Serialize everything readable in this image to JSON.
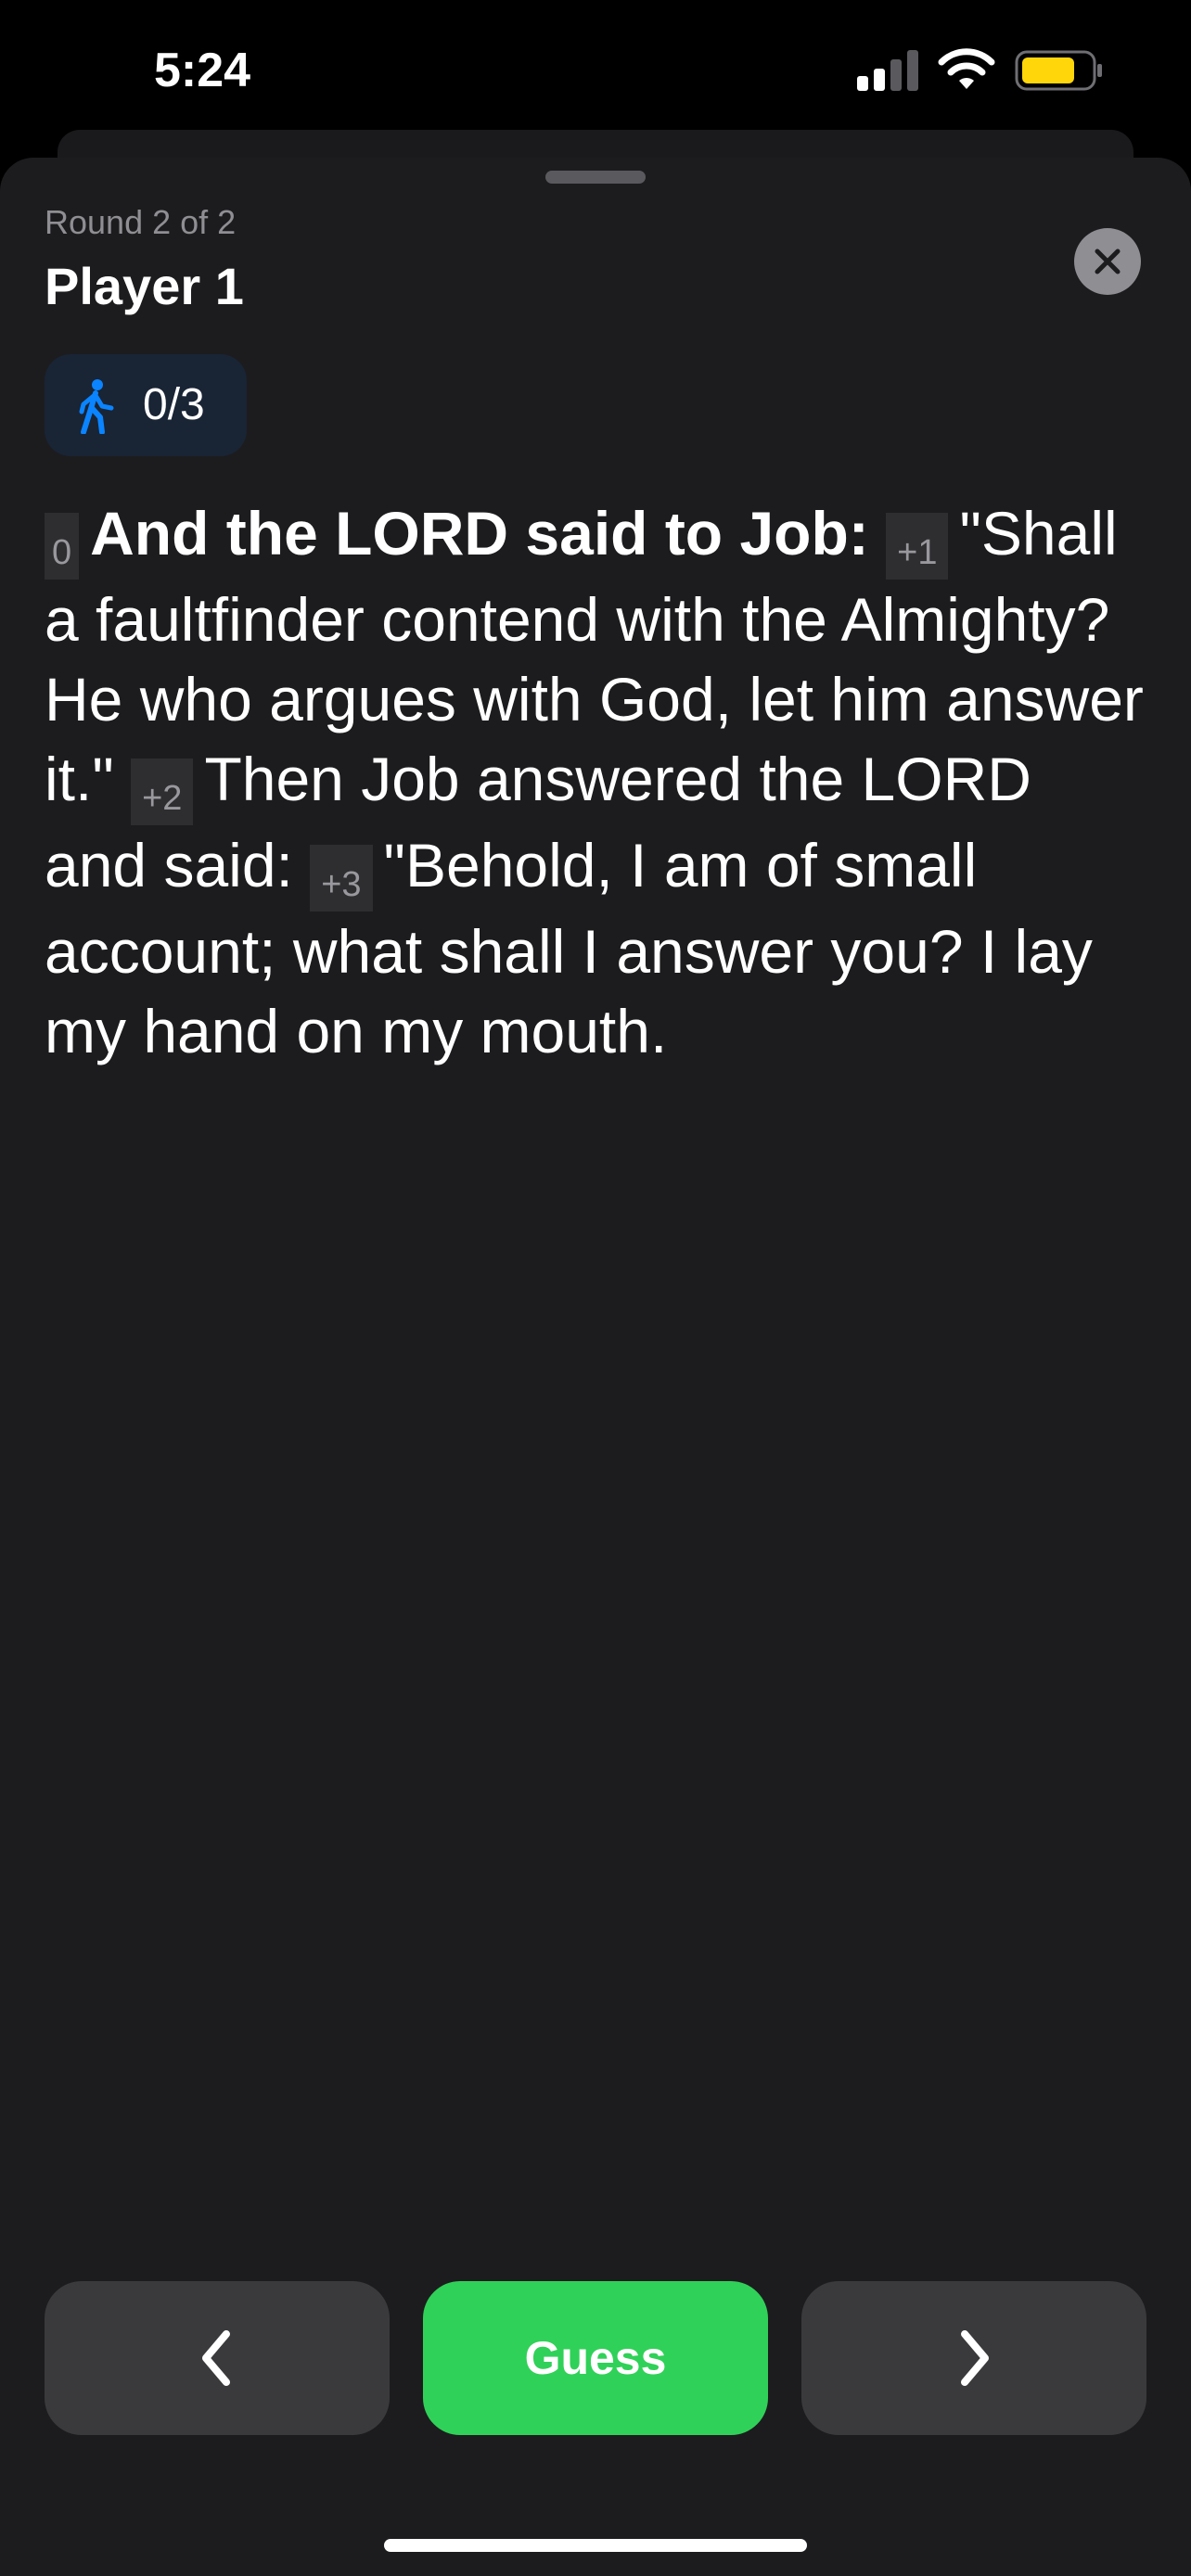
{
  "status_bar": {
    "time": "5:24",
    "battery_color": "#ffd60a"
  },
  "header": {
    "round_label": "Round 2 of 2",
    "player_title": "Player 1"
  },
  "counter": {
    "icon": "walking-figure-icon",
    "value": "0/3",
    "accent_color": "#0a84ff"
  },
  "passage": {
    "segments": [
      {
        "marker": "0",
        "text": "And the LORD said to Job:",
        "bold": true
      },
      {
        "marker": "+1",
        "text": "\"Shall a faultfinder contend with the Almighty? He who argues with God, let him answer it.\""
      },
      {
        "marker": "+2",
        "text": "Then Job answered the LORD and said:"
      },
      {
        "marker": "+3",
        "text": "\"Behold, I am of small account; what shall I answer you? I lay my hand on my mouth."
      }
    ]
  },
  "buttons": {
    "prev_icon": "chevron-left-icon",
    "guess_label": "Guess",
    "next_icon": "chevron-right-icon",
    "guess_color": "#30d158"
  }
}
